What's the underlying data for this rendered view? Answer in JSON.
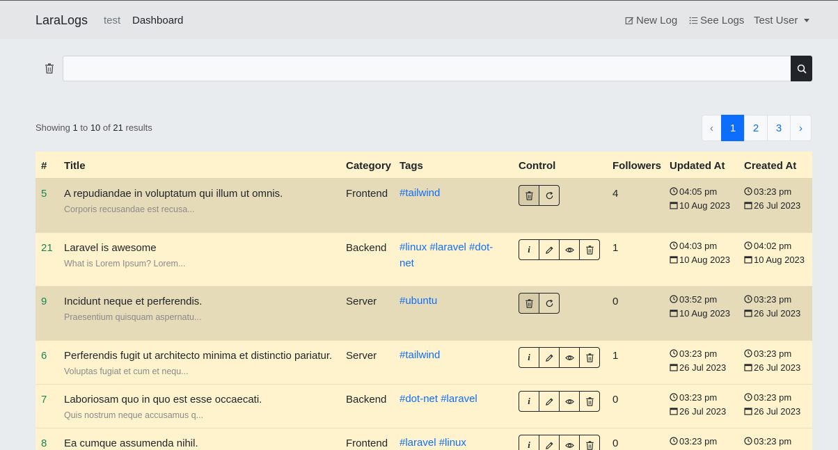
{
  "nav": {
    "brand": "LaraLogs",
    "links": [
      "test",
      "Dashboard"
    ],
    "new_log": "New Log",
    "see_logs": "See Logs",
    "user": "Test User"
  },
  "search": {
    "placeholder": ""
  },
  "results": {
    "prefix": "Showing",
    "from": "1",
    "to_word": "to",
    "to": "10",
    "of_word": "of",
    "total": "21",
    "suffix": "results"
  },
  "pagination": [
    "‹",
    "1",
    "2",
    "3",
    "›"
  ],
  "columns": [
    "#",
    "Title",
    "Category",
    "Tags",
    "Control",
    "Followers",
    "Updated At",
    "Created At"
  ],
  "rows": [
    {
      "id": "5",
      "title": "A repudiandae in voluptatum qui illum ut omnis.",
      "subtitle": "Corporis recusandae est recusa...",
      "category": "Frontend",
      "tags": "#tailwind",
      "followers": "4",
      "updated_time": "04:05 pm",
      "updated_date": "10 Aug 2023",
      "created_time": "03:23 pm",
      "created_date": "26 Jul 2023",
      "deleted": true
    },
    {
      "id": "21",
      "title": "Laravel is awesome",
      "subtitle": "What is Lorem Ipsum? Lorem...",
      "category": "Backend",
      "tags": "#linux #laravel #dot-net",
      "followers": "1",
      "updated_time": "04:03 pm",
      "updated_date": "10 Aug 2023",
      "created_time": "04:02 pm",
      "created_date": "10 Aug 2023",
      "deleted": false
    },
    {
      "id": "9",
      "title": "Incidunt neque et perferendis.",
      "subtitle": "Praesentium quisquam aspernatu...",
      "category": "Server",
      "tags": "#ubuntu",
      "followers": "0",
      "updated_time": "03:52 pm",
      "updated_date": "10 Aug 2023",
      "created_time": "03:23 pm",
      "created_date": "26 Jul 2023",
      "deleted": true
    },
    {
      "id": "6",
      "title": "Perferendis fugit ut architecto minima et distinctio pariatur.",
      "subtitle": "Voluptas fugiat et cum et nequ...",
      "category": "Server",
      "tags": "#tailwind",
      "followers": "1",
      "updated_time": "03:23 pm",
      "updated_date": "26 Jul 2023",
      "created_time": "03:23 pm",
      "created_date": "26 Jul 2023",
      "deleted": false
    },
    {
      "id": "7",
      "title": "Laboriosam quo in quo est esse occaecati.",
      "subtitle": "Quis nostrum neque accusamus q...",
      "category": "Backend",
      "tags": "#dot-net #laravel",
      "followers": "0",
      "updated_time": "03:23 pm",
      "updated_date": "26 Jul 2023",
      "created_time": "03:23 pm",
      "created_date": "26 Jul 2023",
      "deleted": false
    },
    {
      "id": "8",
      "title": "Ea cumque assumenda nihil.",
      "subtitle": "",
      "category": "Frontend",
      "tags": "#laravel #linux",
      "followers": "0",
      "updated_time": "03:23 pm",
      "updated_date": "",
      "created_time": "03:23 pm",
      "created_date": "",
      "deleted": false
    }
  ]
}
